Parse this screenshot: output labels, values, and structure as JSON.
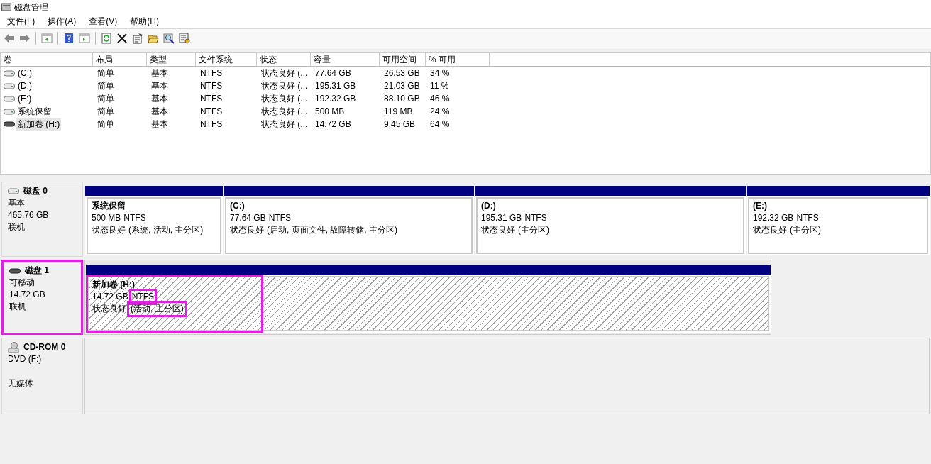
{
  "window": {
    "title": "磁盘管理"
  },
  "menu": [
    "文件(F)",
    "操作(A)",
    "查看(V)",
    "帮助(H)"
  ],
  "table": {
    "columns": [
      "卷",
      "布局",
      "类型",
      "文件系统",
      "状态",
      "容量",
      "可用空间",
      "% 可用"
    ],
    "rows": [
      {
        "cells": [
          "(C:)",
          "简单",
          "基本",
          "NTFS",
          "状态良好 (...",
          "77.64 GB",
          "26.53 GB",
          "34 %"
        ],
        "selected": false,
        "kind": "fixed"
      },
      {
        "cells": [
          "(D:)",
          "简单",
          "基本",
          "NTFS",
          "状态良好 (...",
          "195.31 GB",
          "21.03 GB",
          "11 %"
        ],
        "selected": false,
        "kind": "fixed"
      },
      {
        "cells": [
          "(E:)",
          "简单",
          "基本",
          "NTFS",
          "状态良好 (...",
          "192.32 GB",
          "88.10 GB",
          "46 %"
        ],
        "selected": false,
        "kind": "fixed"
      },
      {
        "cells": [
          "系统保留",
          "简单",
          "基本",
          "NTFS",
          "状态良好 (...",
          "500 MB",
          "119 MB",
          "24 %"
        ],
        "selected": false,
        "kind": "fixed"
      },
      {
        "cells": [
          "新加卷 (H:)",
          "简单",
          "基本",
          "NTFS",
          "状态良好 (...",
          "14.72 GB",
          "9.45 GB",
          "64 %"
        ],
        "selected": true,
        "kind": "removable"
      }
    ]
  },
  "disks": [
    {
      "kind": "fixed",
      "name": "磁盘 0",
      "lines": [
        "基本",
        "465.76 GB",
        "联机"
      ],
      "highlighted": false,
      "partitions": [
        {
          "name": "系统保留",
          "size": "500 MB",
          "fs": "NTFS",
          "status": "状态良好",
          "flags": "(系统, 活动, 主分区)",
          "selected": false,
          "highlighted": false,
          "fs_highlighted": false,
          "flags_highlighted": false
        },
        {
          "name": "(C:)",
          "size": "77.64 GB",
          "fs": "NTFS",
          "status": "状态良好",
          "flags": "(启动, 页面文件, 故障转储, 主分区)",
          "selected": false,
          "highlighted": false,
          "fs_highlighted": false,
          "flags_highlighted": false
        },
        {
          "name": "(D:)",
          "size": "195.31 GB",
          "fs": "NTFS",
          "status": "状态良好",
          "flags": "(主分区)",
          "selected": false,
          "highlighted": false,
          "fs_highlighted": false,
          "flags_highlighted": false
        },
        {
          "name": "(E:)",
          "size": "192.32 GB",
          "fs": "NTFS",
          "status": "状态良好",
          "flags": "(主分区)",
          "selected": false,
          "highlighted": false,
          "fs_highlighted": false,
          "flags_highlighted": false
        }
      ]
    },
    {
      "kind": "removable",
      "name": "磁盘 1",
      "lines": [
        "可移动",
        "14.72 GB",
        "联机"
      ],
      "highlighted": true,
      "partitions": [
        {
          "name": "新加卷 (H:)",
          "size": "14.72 GB",
          "fs": "NTFS",
          "status": "状态良好",
          "flags": "(活动, 主分区)",
          "selected": true,
          "highlighted": true,
          "fs_highlighted": true,
          "flags_highlighted": true
        }
      ]
    },
    {
      "kind": "cdrom",
      "name": "CD-ROM 0",
      "lines": [
        "DVD (F:)",
        "无媒体"
      ],
      "highlighted": false
    }
  ]
}
